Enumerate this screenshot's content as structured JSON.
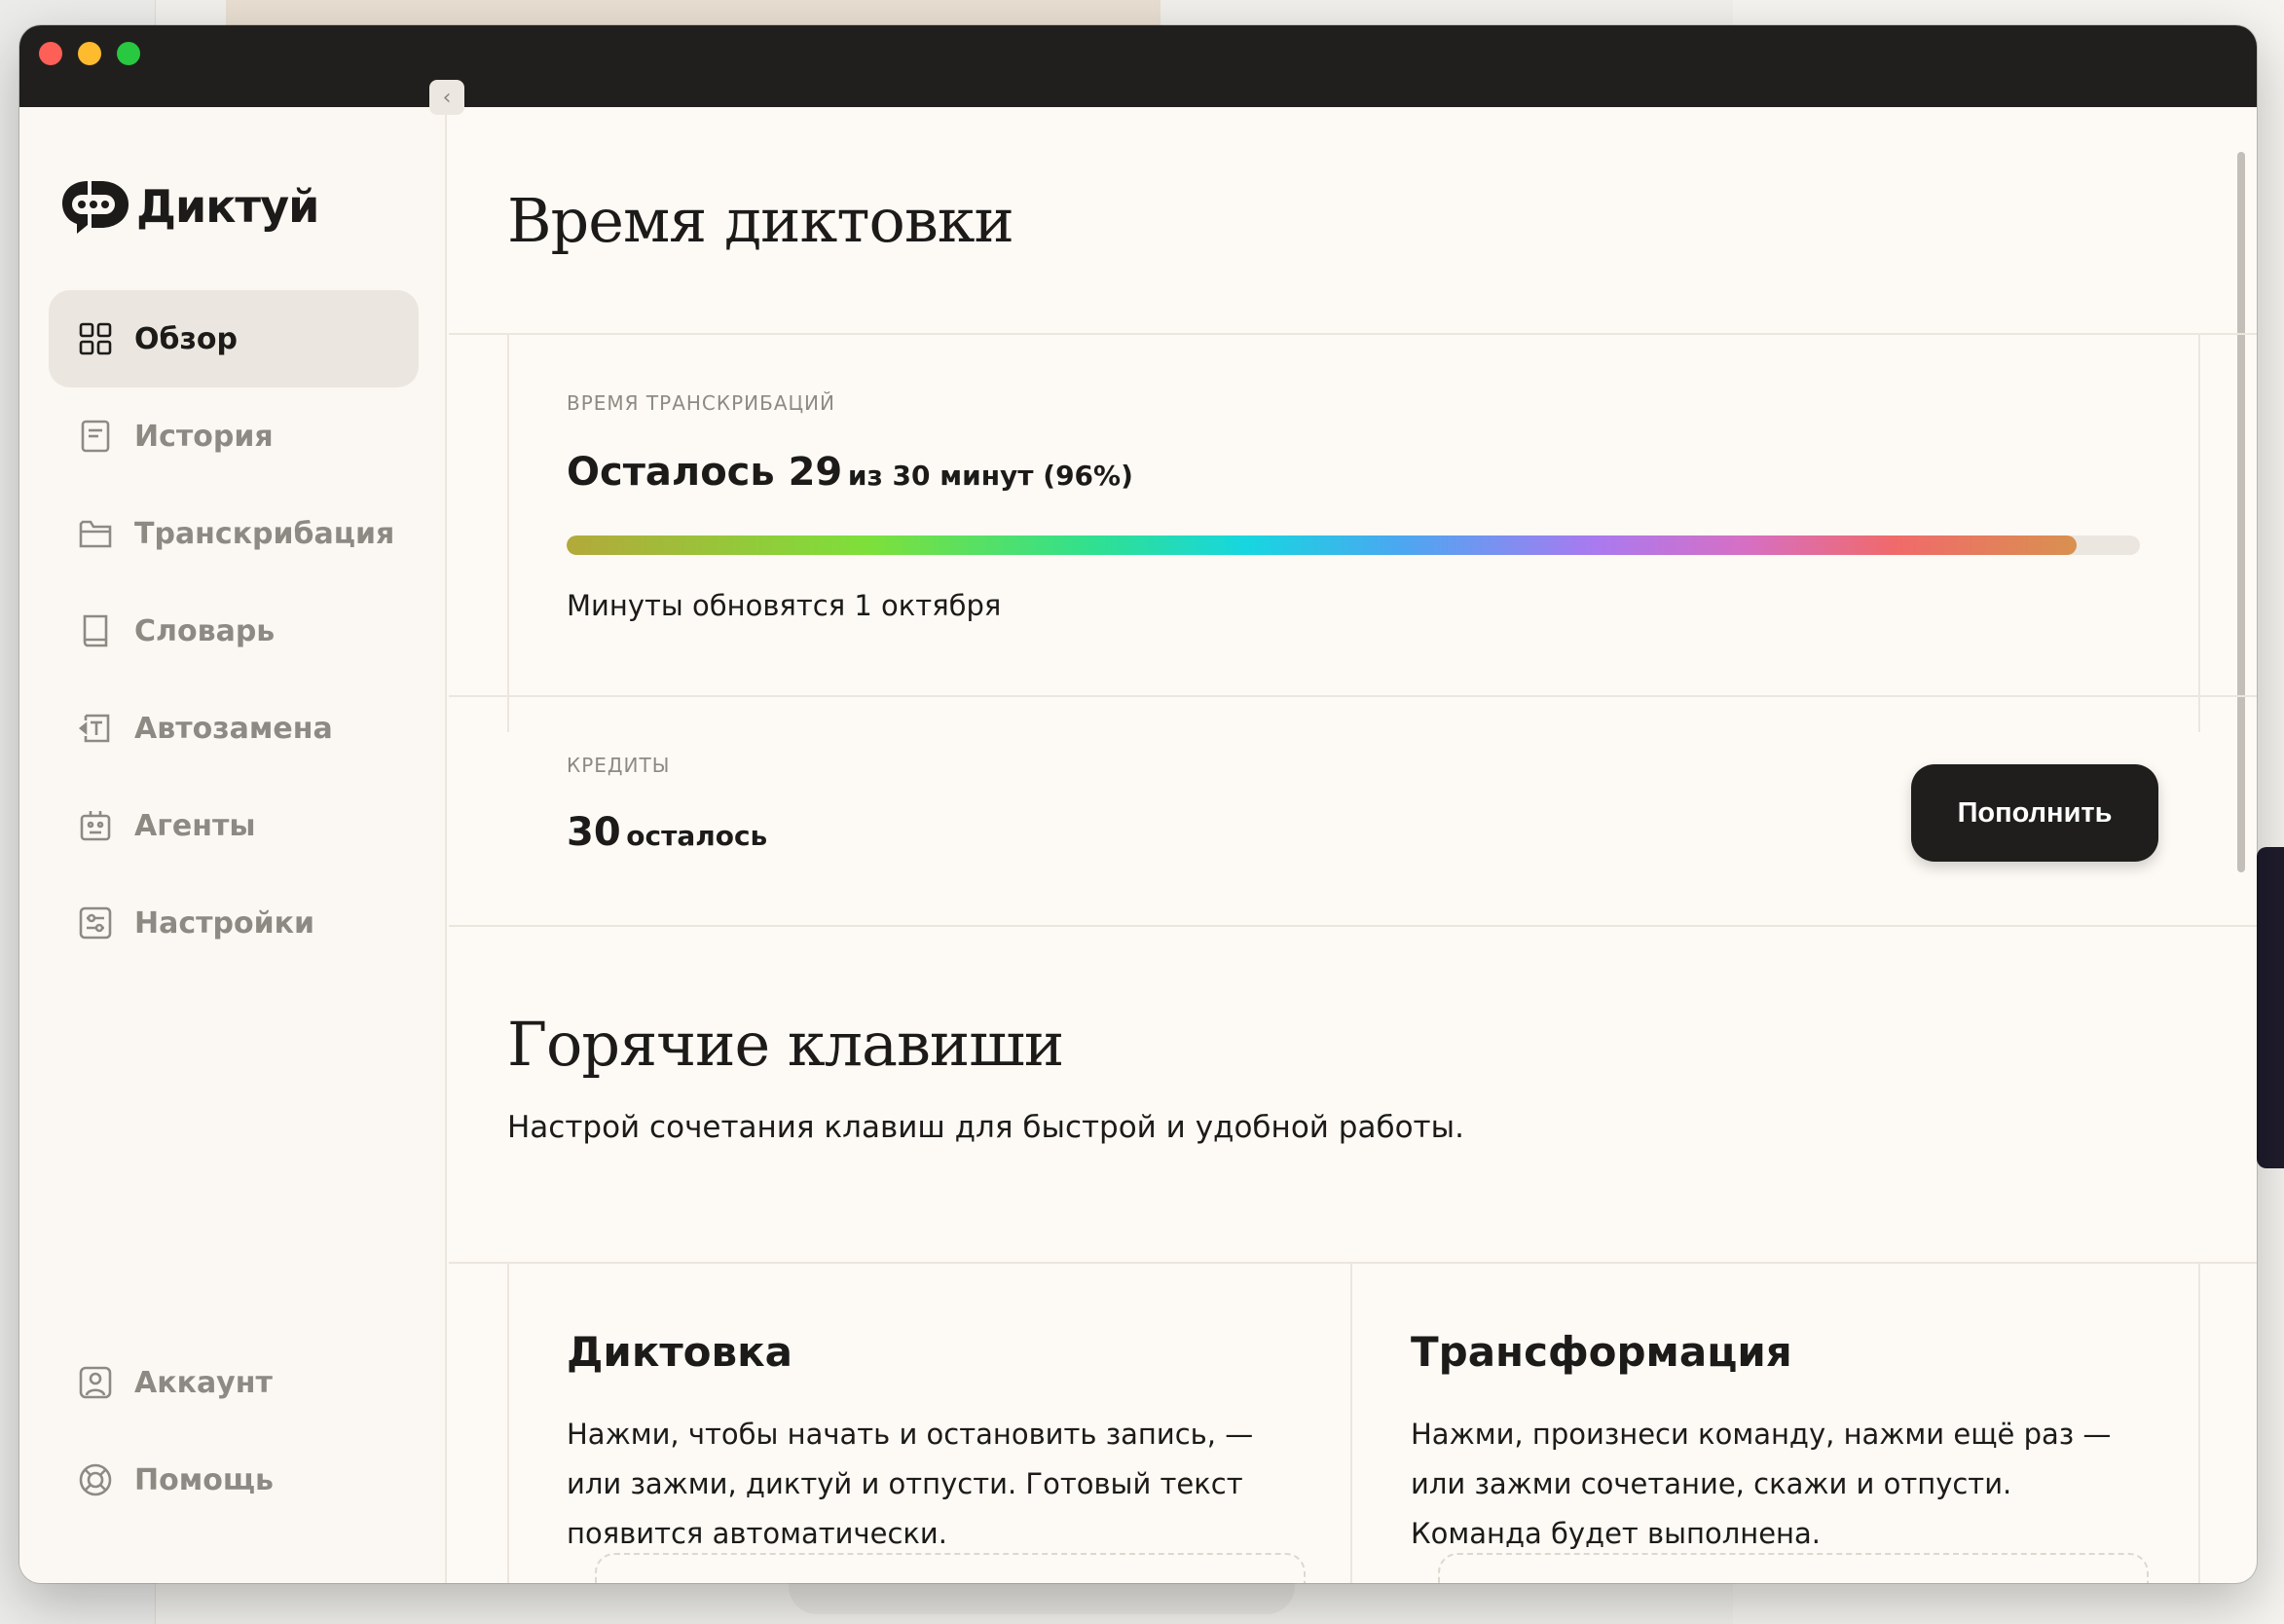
{
  "app": {
    "name": "Диктуй",
    "collapse_icon": "chevron-left-icon"
  },
  "sidebar": {
    "items": [
      {
        "label": "Обзор",
        "icon": "grid-icon",
        "active": true
      },
      {
        "label": "История",
        "icon": "document-icon",
        "active": false
      },
      {
        "label": "Транскрибация",
        "icon": "folder-icon",
        "active": false
      },
      {
        "label": "Словарь",
        "icon": "book-icon",
        "active": false
      },
      {
        "label": "Автозамена",
        "icon": "text-replace-icon",
        "active": false
      },
      {
        "label": "Агенты",
        "icon": "robot-icon",
        "active": false
      },
      {
        "label": "Настройки",
        "icon": "sliders-icon",
        "active": false
      }
    ],
    "bottom_items": [
      {
        "label": "Аккаунт",
        "icon": "user-icon"
      },
      {
        "label": "Помощь",
        "icon": "lifebuoy-icon"
      }
    ]
  },
  "dictation_time": {
    "title": "Время диктовки",
    "label": "Время транскрибаций",
    "remaining_prefix": "Осталось 29",
    "remaining_suffix": "из 30 минут (96%)",
    "progress_percent": 96,
    "note": "Минуты обновятся 1 октября"
  },
  "credits": {
    "label": "Кредиты",
    "value": "30",
    "value_suffix": "осталось",
    "button_label": "Пополнить"
  },
  "hotkeys": {
    "title": "Горячие клавиши",
    "subtitle": "Настрой сочетания клавиш для быстрой и удобной работы.",
    "cards": [
      {
        "title": "Диктовка",
        "description": "Нажми, чтобы начать и остановить запись, — или зажми, диктуй и отпусти. Готовый текст появится автоматически."
      },
      {
        "title": "Трансформация",
        "description": "Нажми, произнеси команду, нажми ещё раз — или зажми сочетание, скажи и отпусти. Команда будет выполнена."
      }
    ]
  },
  "colors": {
    "window_bg": "#fdfaf5",
    "titlebar": "#201f1d",
    "active_nav": "#ebe7e0",
    "button_dark": "#1f1e1c"
  }
}
